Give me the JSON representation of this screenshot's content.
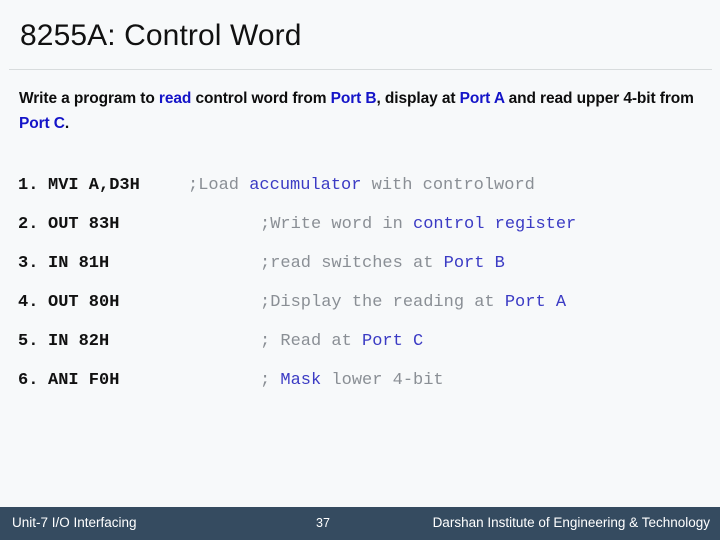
{
  "slide": {
    "title": "8255A: Control Word",
    "intro": {
      "seg1": "Write a program to ",
      "seg2": "read",
      "seg3": " control word from ",
      "seg4": "Port B",
      "seg5": ", display at ",
      "seg6": "Port A",
      "seg7": " and read upper 4-bit from ",
      "seg8": "Port C",
      "seg9": "."
    },
    "code": [
      {
        "num": "1.",
        "instr": "MVI A,D3H",
        "comment_pre": ";Load ",
        "comment_hl": "accumulator",
        "comment_post": " with controlword"
      },
      {
        "num": "2.",
        "instr": "OUT 83H",
        "comment_pre": ";Write word in ",
        "comment_hl": "control register",
        "comment_post": ""
      },
      {
        "num": "3.",
        "instr": "IN 81H",
        "comment_pre": ";read switches at ",
        "comment_hl": "Port B",
        "comment_post": ""
      },
      {
        "num": "4.",
        "instr": "OUT 80H",
        "comment_pre": ";Display the reading at ",
        "comment_hl": "Port A",
        "comment_post": ""
      },
      {
        "num": "5.",
        "instr": "IN 82H",
        "comment_pre": "; Read at ",
        "comment_hl": "Port C",
        "comment_post": ""
      },
      {
        "num": "6.",
        "instr": "ANI F0H",
        "comment_pre": "; ",
        "comment_hl": "Mask",
        "comment_post": " lower 4-bit"
      }
    ],
    "footer": {
      "unit": "Unit-7 I/O Interfacing",
      "page": "37",
      "institute": "Darshan Institute of Engineering & Technology"
    },
    "colors": {
      "accent_blue": "#1414c8",
      "code_blue": "#3b3bc4",
      "comment_gray": "#8a8f95",
      "footer_bg": "#354b60",
      "background": "#f7f9fa"
    }
  }
}
